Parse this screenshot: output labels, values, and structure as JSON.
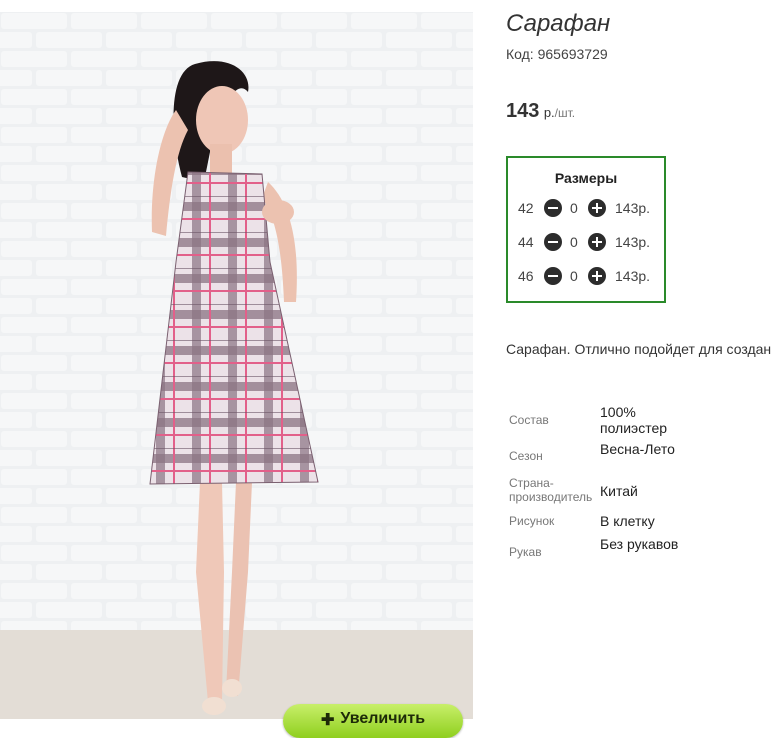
{
  "product": {
    "title": "Сарафан",
    "code_label": "Код:",
    "code_value": "965693729",
    "price": "143",
    "currency": "р.",
    "unit": "/шт."
  },
  "sizes": {
    "heading": "Размеры",
    "rows": [
      {
        "size": "42",
        "qty": "0",
        "price": "143р."
      },
      {
        "size": "44",
        "qty": "0",
        "price": "143р."
      },
      {
        "size": "46",
        "qty": "0",
        "price": "143р."
      }
    ]
  },
  "description": "Сарафан. Отлично подойдет для создан",
  "specs": [
    {
      "key": "Состав",
      "value": "100% полиэстер"
    },
    {
      "key": "Сезон",
      "value": "Весна-Лето"
    },
    {
      "key": "Страна-производитель",
      "value": "Китай"
    },
    {
      "key": "Рисунок",
      "value": "В клетку"
    },
    {
      "key": "Рукав",
      "value": "Без рукавов"
    }
  ],
  "enlarge_button": "Увеличить",
  "colors": {
    "accent_border": "#2a8a2a",
    "button_green": "#8fcf1e"
  }
}
